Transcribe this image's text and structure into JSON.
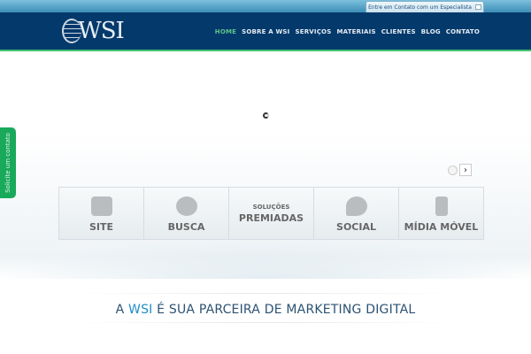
{
  "header": {
    "contact_button": "Entre em Contato com um Especialista",
    "logo": "WSI",
    "nav": [
      {
        "label": "HOME",
        "active": true
      },
      {
        "label": "SOBRE A WSI"
      },
      {
        "label": "SERVIÇOS"
      },
      {
        "label": "MATERIAIS"
      },
      {
        "label": "CLIENTES"
      },
      {
        "label": "BLOG"
      },
      {
        "label": "CONTATO"
      }
    ]
  },
  "side_tab": "Solicite um contato",
  "slider": {
    "next": "›"
  },
  "tiles": [
    {
      "label": "SITE"
    },
    {
      "label": "BUSCA"
    },
    {
      "small": "SOLUÇÕES",
      "big": "PREMIADAS"
    },
    {
      "label": "SOCIAL"
    },
    {
      "label": "MÍDIA MÓVEL"
    }
  ],
  "tagline": {
    "pre": "A ",
    "highlight": "WSI",
    "post": " É SUA PARCEIRA DE MARKETING DIGITAL"
  },
  "colors": {
    "navy": "#04396b",
    "green": "#19a95a",
    "accent": "#1f8fc5"
  }
}
